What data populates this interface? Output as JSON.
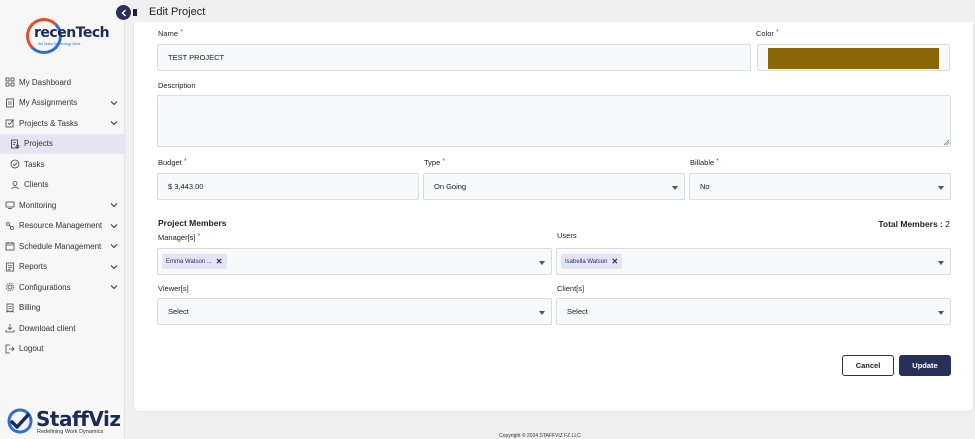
{
  "app": {
    "brand": "recenTech",
    "brand_tagline": "We Make Technology Work",
    "footer_brand": "StaffViz",
    "footer_tagline": "Redefining Work Dynamics"
  },
  "page_title": "Edit Project",
  "sidebar": {
    "items": [
      {
        "label": "My Dashboard",
        "icon": "dashboard-icon"
      },
      {
        "label": "My Assignments",
        "icon": "assignments-icon",
        "chevron": true
      },
      {
        "label": "Projects & Tasks",
        "icon": "projects-tasks-icon",
        "chevron": true
      },
      {
        "label": "Projects",
        "icon": "projects-icon",
        "active": true,
        "sub": true
      },
      {
        "label": "Tasks",
        "icon": "tasks-icon",
        "sub": true
      },
      {
        "label": "Clients",
        "icon": "clients-icon",
        "sub": true
      },
      {
        "label": "Monitoring",
        "icon": "monitoring-icon",
        "chevron": true
      },
      {
        "label": "Resource Management",
        "icon": "resource-icon",
        "chevron": true
      },
      {
        "label": "Schedule Management",
        "icon": "schedule-icon",
        "chevron": true
      },
      {
        "label": "Reports",
        "icon": "reports-icon",
        "chevron": true
      },
      {
        "label": "Configurations",
        "icon": "configurations-icon",
        "chevron": true
      },
      {
        "label": "Billing",
        "icon": "billing-icon"
      },
      {
        "label": "Download client",
        "icon": "download-icon"
      },
      {
        "label": "Logout",
        "icon": "logout-icon"
      }
    ]
  },
  "form": {
    "name_label": "Name",
    "name_value": "TEST PROJECT",
    "color_label": "Color",
    "color_value": "#8a6606",
    "description_label": "Description",
    "description_value": "",
    "budget_label": "Budget",
    "budget_value": "$ 3,443.00",
    "type_label": "Type",
    "type_value": "On Going",
    "billable_label": "Billable",
    "billable_value": "No",
    "required_mark": "*"
  },
  "members": {
    "section_title": "Project Members",
    "total_label": "Total Members :",
    "total_value": "2",
    "managers_label": "Manager[s]",
    "managers_chip": "Emma Watson ...",
    "users_label": "Users",
    "users_chip": "Isabella Watson",
    "viewers_label": "Viewer[s]",
    "viewers_value": "Select",
    "clients_label": "Client[s]",
    "clients_value": "Select"
  },
  "actions": {
    "cancel_label": "Cancel",
    "update_label": "Update"
  },
  "footer": {
    "copyright": "Copyright © 2024 STAFFVIZ FZ LLC"
  },
  "colors": {
    "accent": "#26305a",
    "active_bg": "#e3e5f4",
    "required": "#d32f2f",
    "swatch": "#8a6606"
  }
}
